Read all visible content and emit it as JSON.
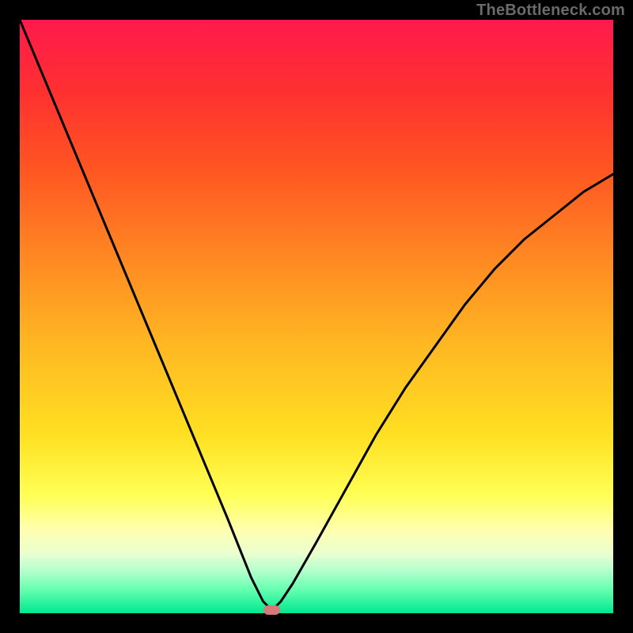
{
  "watermark": "TheBottleneck.com",
  "chart_data": {
    "type": "line",
    "title": "",
    "xlabel": "",
    "ylabel": "",
    "xlim": [
      0,
      100
    ],
    "ylim": [
      0,
      100
    ],
    "series": [
      {
        "name": "curve",
        "x": [
          0,
          5,
          10,
          15,
          20,
          25,
          30,
          35,
          39,
          41,
          42.5,
          44,
          46,
          50,
          55,
          60,
          65,
          70,
          75,
          80,
          85,
          90,
          95,
          100
        ],
        "y": [
          100,
          88,
          76,
          64,
          52,
          40,
          28,
          16,
          6,
          2,
          0.5,
          2,
          5,
          12,
          21,
          30,
          38,
          45,
          52,
          58,
          63,
          67,
          71,
          74
        ]
      }
    ],
    "marker": {
      "x": 42.5,
      "y": 0.5,
      "w": 2.8,
      "h": 1.6
    },
    "background_gradient": {
      "top": "#ff1a4d",
      "mid": "#ffe022",
      "bottom": "#00e890"
    }
  }
}
